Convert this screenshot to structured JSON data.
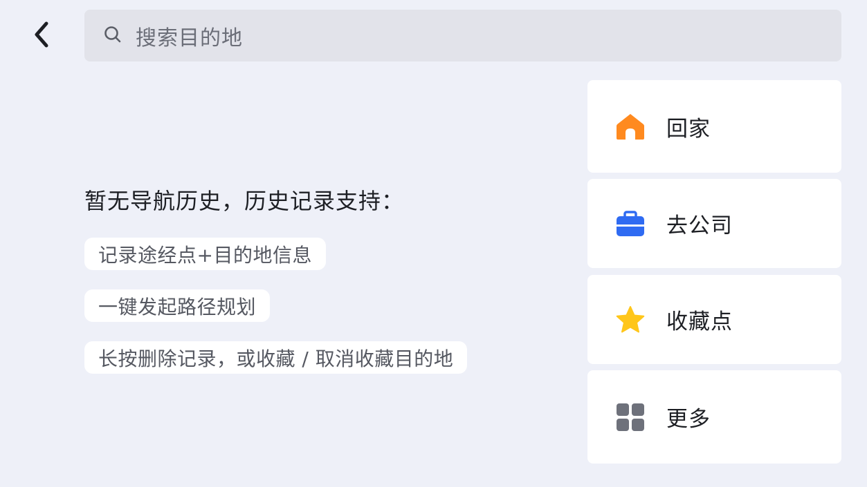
{
  "search": {
    "placeholder": "搜索目的地"
  },
  "empty_state": {
    "title": "暂无导航历史，历史记录支持：",
    "tips": [
      "记录途经点+目的地信息",
      "一键发起路径规划",
      "长按删除记录，或收藏 / 取消收藏目的地"
    ]
  },
  "shortcuts": [
    {
      "label": "回家",
      "icon": "home-icon",
      "color": "#ff8a1f"
    },
    {
      "label": "去公司",
      "icon": "briefcase-icon",
      "color": "#2f6bf2"
    },
    {
      "label": "收藏点",
      "icon": "star-icon",
      "color": "#ffc61a"
    },
    {
      "label": "更多",
      "icon": "grid-icon",
      "color": "#6e717b"
    }
  ],
  "colors": {
    "background": "#eef0f8",
    "search_bg": "#e2e3ea",
    "card_bg": "#ffffff",
    "text_primary": "#1d1f24",
    "text_secondary": "#555861"
  }
}
